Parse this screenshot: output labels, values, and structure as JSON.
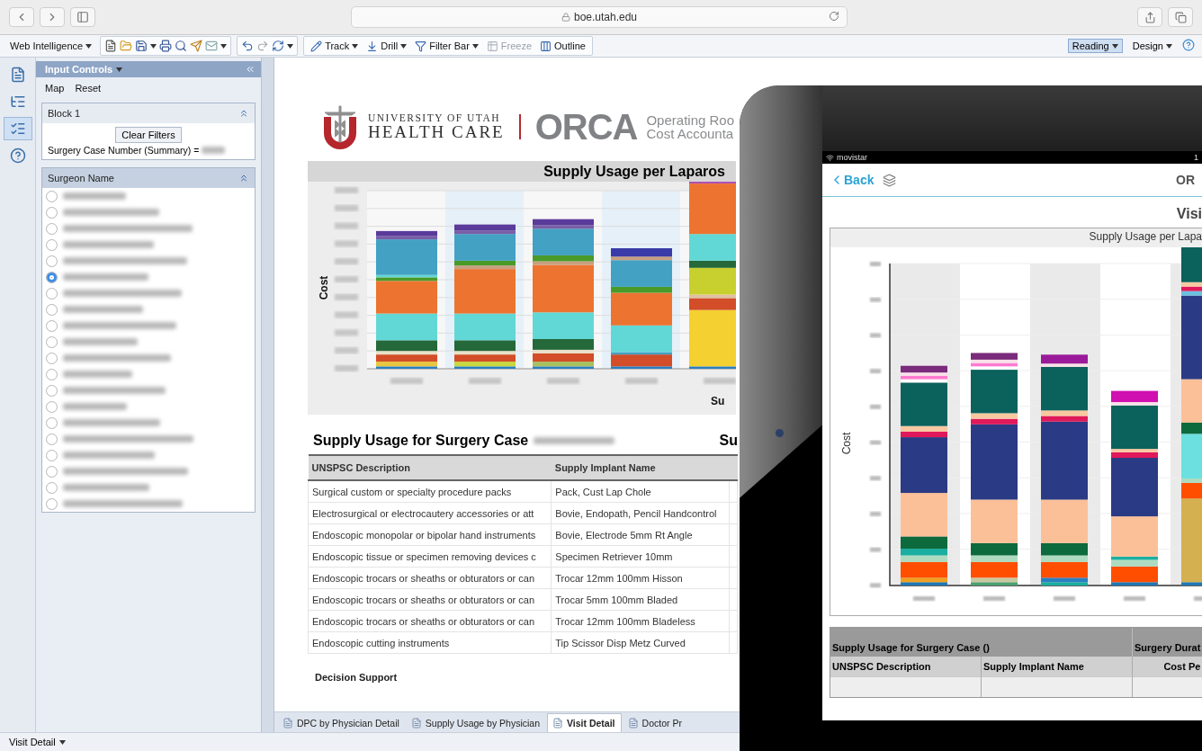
{
  "browser": {
    "address": "boe.utah.edu"
  },
  "toolbar": {
    "app_menu": "Web Intelligence",
    "actions": [
      {
        "label": "Track",
        "kind": "track",
        "disabled": false
      },
      {
        "label": "Drill",
        "kind": "drill",
        "disabled": false
      },
      {
        "label": "Filter Bar",
        "kind": "filter",
        "disabled": false
      },
      {
        "label": "Freeze",
        "kind": "freeze",
        "disabled": true
      },
      {
        "label": "Outline",
        "kind": "outline",
        "disabled": false
      }
    ],
    "modes": [
      {
        "label": "Reading",
        "selected": true
      },
      {
        "label": "Design",
        "selected": false
      }
    ]
  },
  "rail": [
    {
      "kind": "document",
      "selected": false
    },
    {
      "kind": "tree",
      "selected": false
    },
    {
      "kind": "controls",
      "selected": true
    },
    {
      "kind": "help",
      "selected": false
    }
  ],
  "input_controls": {
    "title": "Input Controls",
    "actions": [
      "Map",
      "Reset"
    ],
    "block": {
      "title": "Block 1",
      "button": "Clear Filters",
      "filter_label": "Surgery Case Number (Summary) ="
    },
    "surgeon_list": {
      "title": "Surgeon Name",
      "options": [
        {
          "selected": false
        },
        {
          "selected": false
        },
        {
          "selected": false
        },
        {
          "selected": false
        },
        {
          "selected": false
        },
        {
          "selected": true
        },
        {
          "selected": false
        },
        {
          "selected": false
        },
        {
          "selected": false
        },
        {
          "selected": false
        },
        {
          "selected": false
        },
        {
          "selected": false
        },
        {
          "selected": false
        },
        {
          "selected": false
        },
        {
          "selected": false
        },
        {
          "selected": false
        },
        {
          "selected": false
        },
        {
          "selected": false
        },
        {
          "selected": false
        },
        {
          "selected": false
        }
      ]
    }
  },
  "report": {
    "logo": {
      "line_1": "UNIVERSITY OF UTAH",
      "line_2": "HEALTH CARE",
      "product": "ORCA",
      "tagline_1": "Operating Roo",
      "tagline_2": "Cost Accounta"
    },
    "chart": {
      "title": "Supply Usage per Laparos",
      "ylabel": "Cost",
      "xlabel": "Su"
    },
    "table_title": "Supply Usage for Surgery Case",
    "table_title_2": "Su",
    "columns": [
      "UNSPSC Description",
      "Supply Implant Name"
    ],
    "rows": [
      [
        "Surgical custom or specialty procedure packs",
        "Pack, Cust Lap Chole"
      ],
      [
        "Electrosurgical or electrocautery accessories or att",
        "Bovie, Endopath, Pencil Handcontrol"
      ],
      [
        "Endoscopic monopolar or bipolar hand instruments",
        "Bovie, Electrode 5mm Rt Angle"
      ],
      [
        "Endoscopic tissue or specimen removing devices c",
        "Specimen Retriever 10mm"
      ],
      [
        "Endoscopic trocars or sheaths or obturators or can",
        "Trocar 12mm 100mm Hisson"
      ],
      [
        "Endoscopic trocars or sheaths or obturators or can",
        "Trocar 5mm 100mm Bladed"
      ],
      [
        "Endoscopic trocars or sheaths or obturators or can",
        "Trocar 12mm 100mm Bladeless"
      ],
      [
        "Endoscopic cutting instruments",
        "Tip Scissor Disp Metz Curved"
      ]
    ],
    "footer": "Decision Support"
  },
  "report_tabs": [
    {
      "label": "DPC by Physician Detail",
      "selected": false
    },
    {
      "label": "Supply Usage by Physician",
      "selected": false
    },
    {
      "label": "Visit Detail",
      "selected": true
    },
    {
      "label": "Doctor Pr",
      "selected": false
    }
  ],
  "status_bar": {
    "label": "Visit Detail"
  },
  "tablet": {
    "carrier": "movistar",
    "clock": "1",
    "back": "Back",
    "nav_title": "OR",
    "page_title": "Visi",
    "chart": {
      "title": "Supply Usage per Lapa",
      "ylabel": "Cost"
    },
    "table": {
      "group_1": "Supply Usage for Surgery Case ()",
      "group_2": "Surgery Durat",
      "columns": [
        "UNSPSC Description",
        "Supply Implant Name",
        "Cost Pe"
      ]
    }
  }
}
